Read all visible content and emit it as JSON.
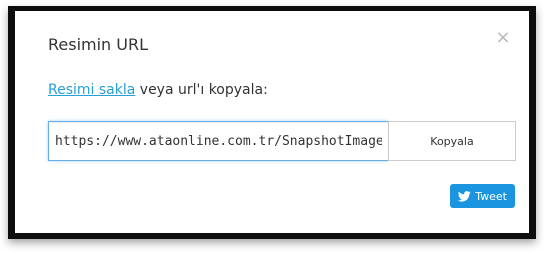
{
  "modal": {
    "title": "Resimin URL",
    "close_glyph": "×",
    "save_link_label": "Resimi sakla",
    "desc_suffix": " veya url'ı kopyala:",
    "url_value": "https://www.ataonline.com.tr/SnapshotImage?id=",
    "copy_label": "Kopyala",
    "tweet_label": "Tweet",
    "tweet_icon": "twitter-bird-icon",
    "colors": {
      "link": "#2a9fd6",
      "tweet_bg": "#1b95e0",
      "input_focus_border": "#66afe9"
    }
  }
}
